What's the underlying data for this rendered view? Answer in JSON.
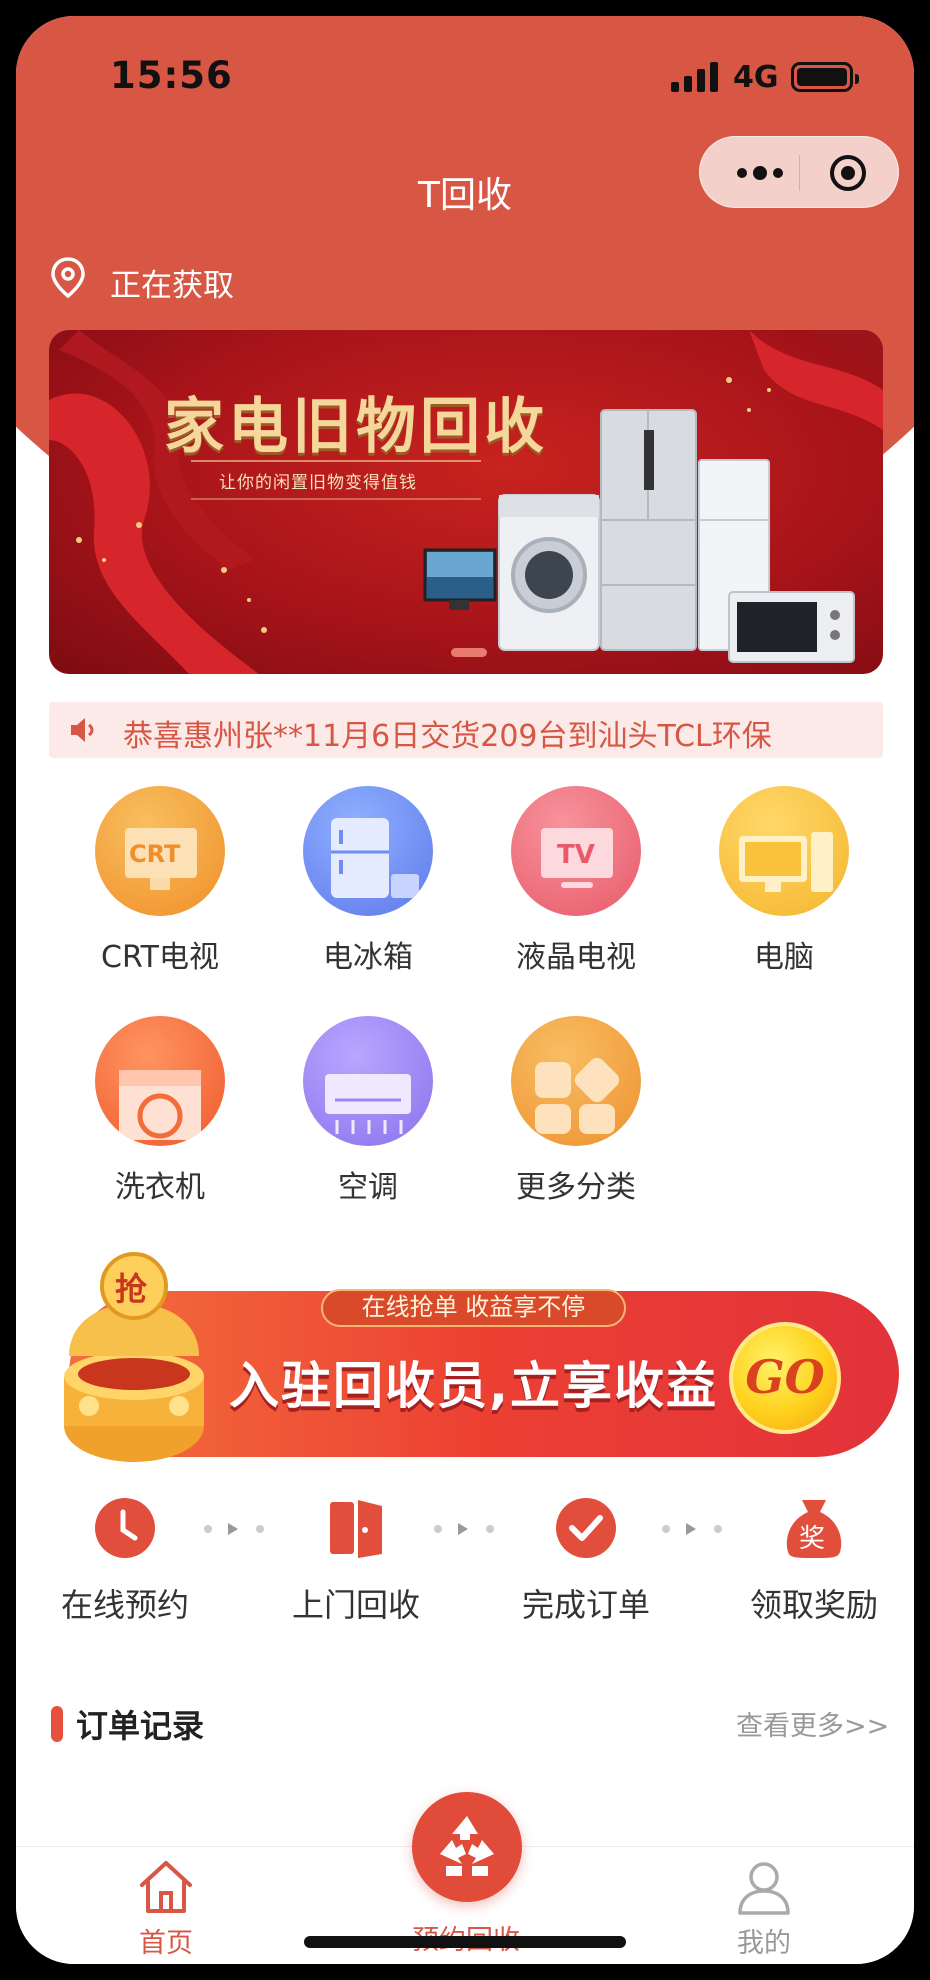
{
  "status_bar": {
    "time": "15:56",
    "network": "4G"
  },
  "nav": {
    "title": "T回收"
  },
  "location": {
    "text": "正在获取"
  },
  "banner": {
    "title": "家电旧物回收",
    "subtitle": "让你的闲置旧物变得值钱"
  },
  "notice": {
    "text": "恭喜惠州张**11月6日交货209台到汕头TCL环保"
  },
  "categories": [
    {
      "label": "CRT电视",
      "icon": "crt-tv-icon",
      "badge": "CRT",
      "color": "#f4a43c"
    },
    {
      "label": "电冰箱",
      "icon": "fridge-icon",
      "color": "#6f8cf0"
    },
    {
      "label": "液晶电视",
      "icon": "lcd-tv-icon",
      "badge": "TV",
      "color": "#ee6a78"
    },
    {
      "label": "电脑",
      "icon": "computer-icon",
      "color": "#f8c33a"
    },
    {
      "label": "洗衣机",
      "icon": "washing-machine-icon",
      "color": "#f36d3a"
    },
    {
      "label": "空调",
      "icon": "air-conditioner-icon",
      "color": "#9b86ef"
    },
    {
      "label": "更多分类",
      "icon": "more-categories-icon",
      "color": "#f1a03b"
    }
  ],
  "recruit": {
    "tag": "在线抢单 收益享不停",
    "main": "入驻回收员,立享收益",
    "go": "GO",
    "badge_char": "抢"
  },
  "steps": [
    {
      "label": "在线预约",
      "icon": "clock-icon"
    },
    {
      "label": "上门回收",
      "icon": "door-icon"
    },
    {
      "label": "完成订单",
      "icon": "check-icon"
    },
    {
      "label": "领取奖励",
      "icon": "reward-bag-icon",
      "badge": "奖"
    }
  ],
  "orders": {
    "title": "订单记录",
    "more": "查看更多>>"
  },
  "tabbar": {
    "home": "首页",
    "book": "预约回收",
    "mine": "我的"
  },
  "colors": {
    "brand": "#d75644",
    "accent": "#e84f3c"
  }
}
